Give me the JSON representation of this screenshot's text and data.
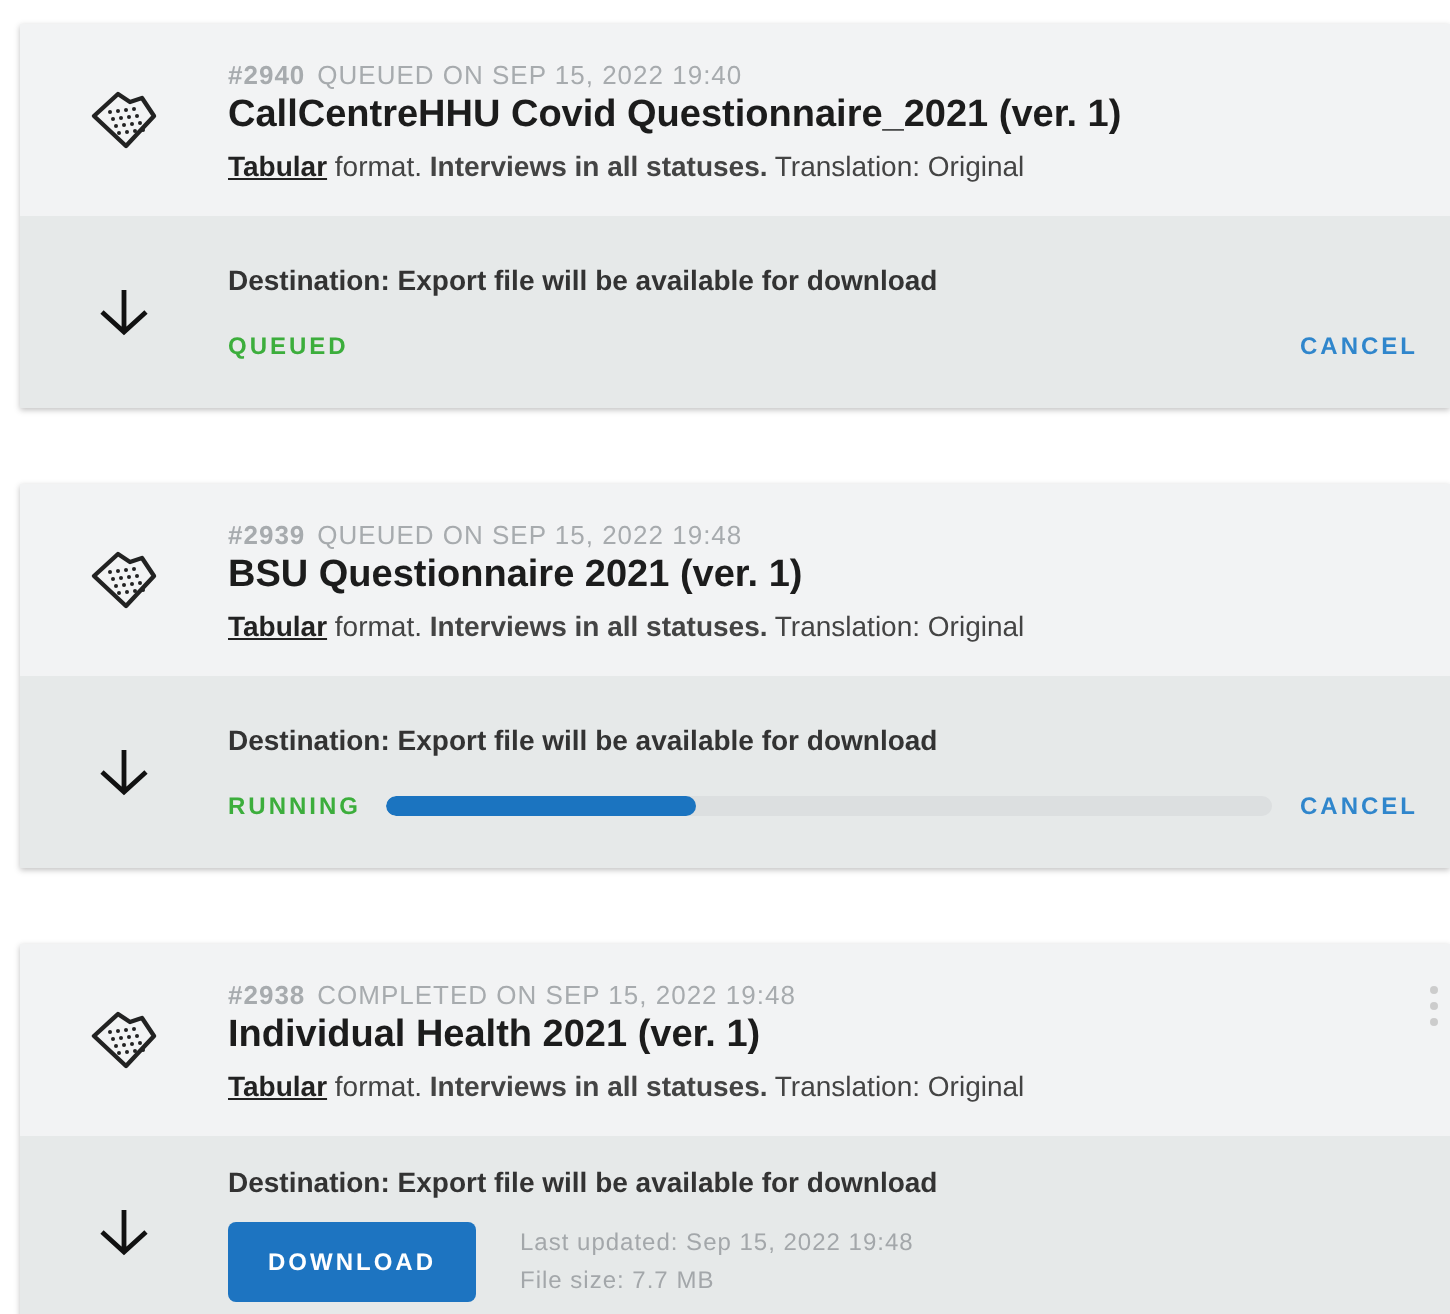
{
  "exports": [
    {
      "number": "#2940",
      "status_line": "QUEUED ON SEP 15, 2022 19:40",
      "title": "CallCentreHHU Covid Questionnaire_2021 (ver. 1)",
      "format_link": "Tabular",
      "description": " format. **Interviews in all statuses.** Translation: Original",
      "destination": "Destination: Export file will be available for download",
      "kind": "queued",
      "state_label": "QUEUED",
      "cancel": "CANCEL",
      "has_menu": false
    },
    {
      "number": "#2939",
      "status_line": "QUEUED ON SEP 15, 2022 19:48",
      "title": "BSU Questionnaire 2021 (ver. 1)",
      "format_link": "Tabular",
      "description": " format. **Interviews in all statuses.** Translation: Original",
      "destination": "Destination: Export file will be available for download",
      "kind": "running",
      "state_label": "RUNNING",
      "level": 0.35,
      "cancel": "CANCEL",
      "has_menu": false
    },
    {
      "number": "#2938",
      "status_line": "COMPLETED ON SEP 15, 2022 19:48",
      "title": "Individual Health 2021 (ver. 1)",
      "format_link": "Tabular",
      "description": " format. **Interviews in all statuses.** Translation: Original",
      "destination": "Destination: Export file will be available for download",
      "kind": "completed",
      "download": "DOWNLOAD",
      "updated": "Last updated: Sep 15, 2022 19:48",
      "file_size": "File size: 7.7 MB",
      "has_menu": true
    }
  ]
}
